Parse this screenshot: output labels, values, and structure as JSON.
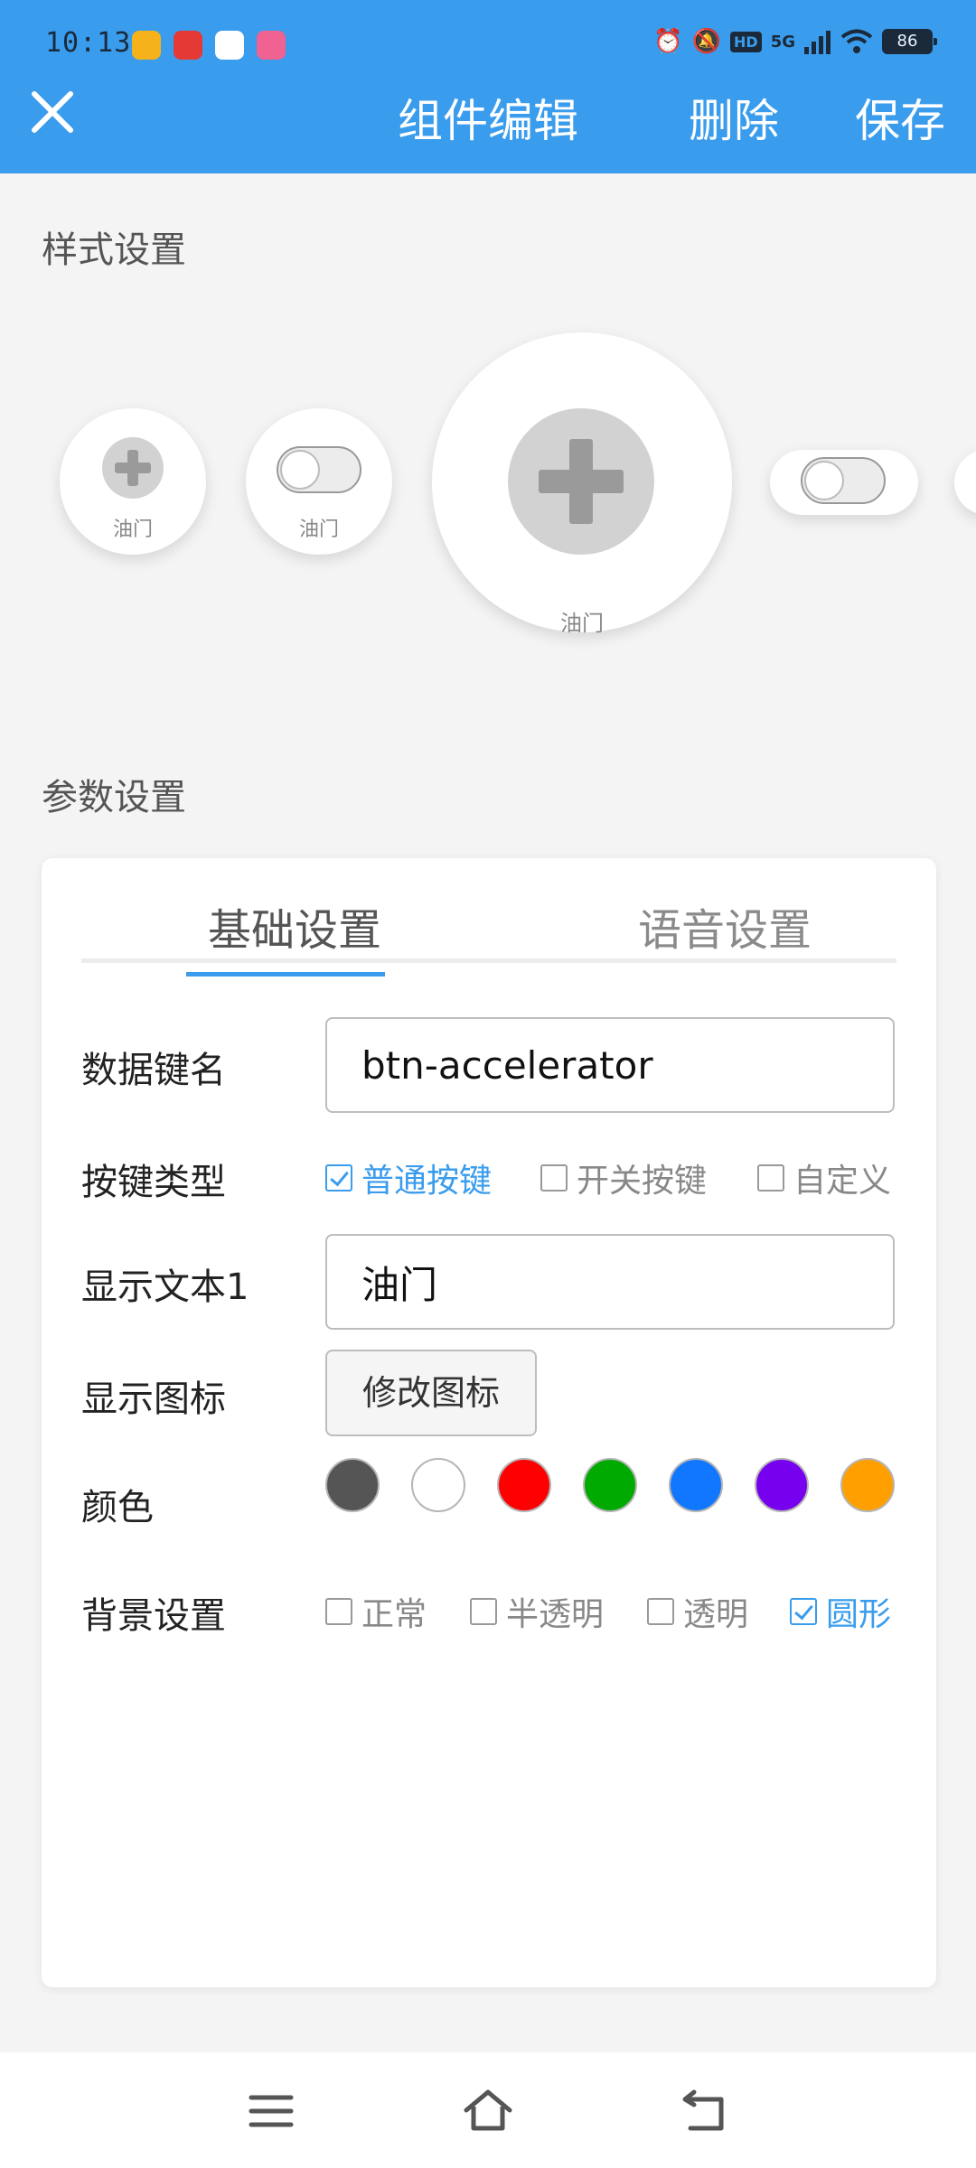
{
  "status_bar": {
    "time": "10:13",
    "net_label": "5G",
    "hd_label": "HD",
    "battery": "86"
  },
  "header": {
    "title": "组件编辑",
    "delete_label": "删除",
    "save_label": "保存"
  },
  "style_section": {
    "label": "样式设置",
    "previews": [
      {
        "kind": "plus",
        "label": "油门"
      },
      {
        "kind": "toggle",
        "label": "油门"
      },
      {
        "kind": "plus",
        "label": "油门",
        "selected": true
      },
      {
        "kind": "toggle",
        "label": ""
      }
    ]
  },
  "params_section": {
    "label": "参数设置",
    "tabs": [
      {
        "label": "基础设置",
        "active": true
      },
      {
        "label": "语音设置",
        "active": false
      }
    ],
    "data_key": {
      "label": "数据键名",
      "value": "btn-accelerator"
    },
    "key_type": {
      "label": "按键类型",
      "options": [
        {
          "label": "普通按键",
          "checked": true
        },
        {
          "label": "开关按键",
          "checked": false
        },
        {
          "label": "自定义",
          "checked": false
        }
      ]
    },
    "display_text": {
      "label": "显示文本1",
      "value": "油门"
    },
    "display_icon": {
      "label": "显示图标",
      "button": "修改图标"
    },
    "color": {
      "label": "颜色",
      "swatches": [
        "#555555",
        "#ffffff",
        "#ff0000",
        "#00aa00",
        "#1177ff",
        "#7700ee",
        "#ffa000"
      ]
    },
    "background": {
      "label": "背景设置",
      "options": [
        {
          "label": "正常",
          "checked": false
        },
        {
          "label": "半透明",
          "checked": false
        },
        {
          "label": "透明",
          "checked": false
        },
        {
          "label": "圆形",
          "checked": true
        }
      ]
    }
  },
  "colors": {
    "accent": "#3a9ced"
  }
}
